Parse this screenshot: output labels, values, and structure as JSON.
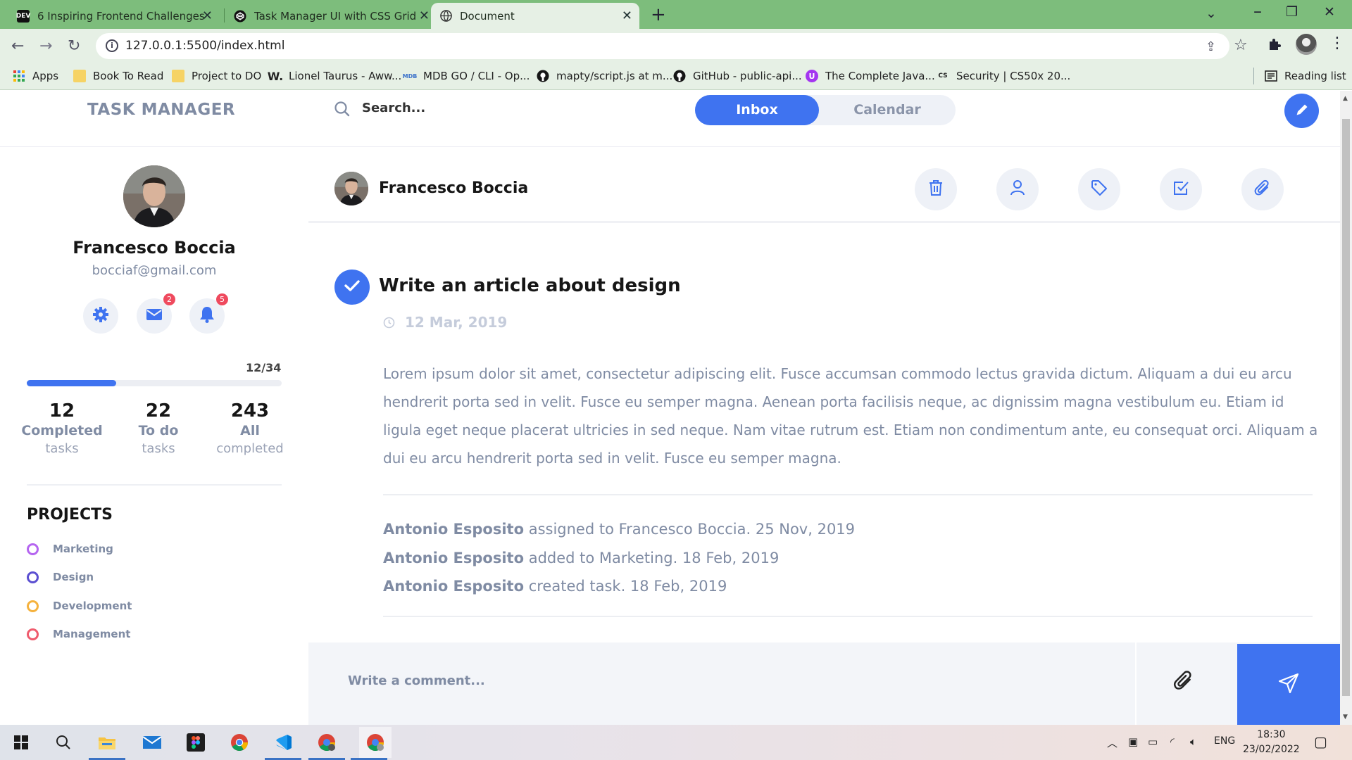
{
  "browser": {
    "tabs": [
      {
        "title": "6 Inspiring Frontend Challenges",
        "icon": "dev-logo-icon"
      },
      {
        "title": "Task Manager UI with CSS Grid",
        "icon": "codepen-icon"
      },
      {
        "title": "Document",
        "icon": "globe-icon",
        "active": true
      }
    ],
    "url": "127.0.0.1:5500/index.html",
    "bookmarks": [
      {
        "label": "Apps",
        "icon": "apps-grid-icon"
      },
      {
        "label": "Book To Read",
        "icon": "folder-icon"
      },
      {
        "label": "Project to DO",
        "icon": "folder-icon"
      },
      {
        "label": "Lionel Taurus - Aww...",
        "icon": "w-logo-icon"
      },
      {
        "label": "MDB GO / CLI - Op...",
        "icon": "mdb-logo-icon"
      },
      {
        "label": "mapty/script.js at m...",
        "icon": "github-icon"
      },
      {
        "label": "GitHub - public-api...",
        "icon": "github-icon"
      },
      {
        "label": "The Complete Java...",
        "icon": "udemy-icon"
      },
      {
        "label": "Security | CS50x 20...",
        "icon": "cs50-icon"
      }
    ],
    "reading_list": "Reading list"
  },
  "header": {
    "logo": "TASK MANAGER",
    "search_placeholder": "Search...",
    "toggle": {
      "inbox": "Inbox",
      "calendar": "Calendar"
    }
  },
  "profile": {
    "name": "Francesco Boccia",
    "email": "bocciaf@gmail.com",
    "mail_badge": "2",
    "notification_badge": "5",
    "progress_label": "12/34",
    "progress_fraction": 0.35,
    "stats": [
      {
        "num": "12",
        "label": "Completed",
        "sub": "tasks"
      },
      {
        "num": "22",
        "label": "To do",
        "sub": "tasks"
      },
      {
        "num": "243",
        "label": "All",
        "sub": "completed"
      }
    ]
  },
  "projects": {
    "title": "PROJECTS",
    "items": [
      {
        "label": "Marketing",
        "color": "#b565f0"
      },
      {
        "label": "Design",
        "color": "#5b4fd1"
      },
      {
        "label": "Development",
        "color": "#f5b23e"
      },
      {
        "label": "Management",
        "color": "#ef5b6d"
      }
    ]
  },
  "task": {
    "author": "Francesco Boccia",
    "title": "Write an article about design",
    "date": "12 Mar, 2019",
    "body": "Lorem ipsum dolor sit amet, consectetur adipiscing elit. Fusce accumsan commodo lectus gravida dictum. Aliquam a dui eu arcu hendrerit porta sed in velit. Fusce eu semper magna. Aenean porta facilisis neque, ac dignissim magna vestibulum eu. Etiam id ligula eget neque placerat ultricies in sed neque. Nam vitae rutrum est. Etiam non condimentum ante, eu consequat orci. Aliquam a dui eu arcu hendrerit porta sed in velit. Fusce eu semper magna.",
    "activity": [
      {
        "who": "Antonio Esposito",
        "what": " assigned to Francesco Boccia. 25 Nov, 2019"
      },
      {
        "who": "Antonio Esposito",
        "what": " added to Marketing. 18 Feb, 2019"
      },
      {
        "who": "Antonio Esposito",
        "what": " created task. 18 Feb, 2019"
      }
    ],
    "comment_placeholder": "Write a comment..."
  },
  "taskbar": {
    "lang": "ENG",
    "time": "18:30",
    "date": "23/02/2022"
  },
  "colors": {
    "accent": "#3f73f0",
    "muted": "#7f8ba3",
    "badge": "#ef4a5e"
  }
}
